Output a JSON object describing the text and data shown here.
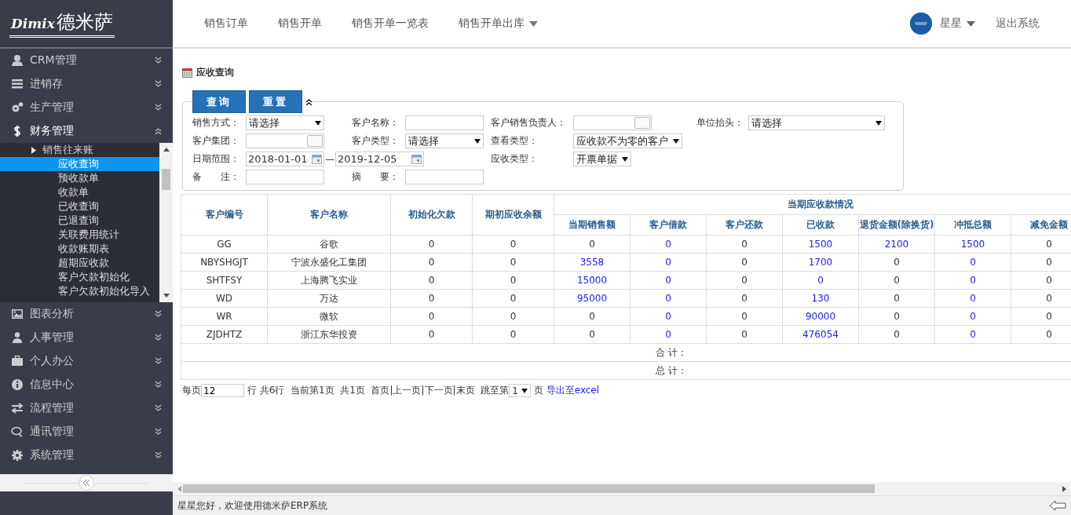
{
  "logo": {
    "script": "Dimix",
    "name": "德米萨"
  },
  "top_nav": [
    {
      "label": "销售订单",
      "dropdown": false
    },
    {
      "label": "销售开单",
      "dropdown": false
    },
    {
      "label": "销售开单一览表",
      "dropdown": false
    },
    {
      "label": "销售开单出库",
      "dropdown": true
    }
  ],
  "user": {
    "name": "星星",
    "logout": "退出系统"
  },
  "sidebar": {
    "items": [
      {
        "label": "CRM管理",
        "expanded": false
      },
      {
        "label": "进销存",
        "expanded": false
      },
      {
        "label": "生产管理",
        "expanded": false
      },
      {
        "label": "财务管理",
        "expanded": true,
        "children": [
          {
            "label": "销售往来账",
            "expanded": true,
            "children": [
              {
                "label": "应收查询",
                "selected": true
              },
              {
                "label": "预收款单",
                "selected": false
              },
              {
                "label": "收款单",
                "selected": false
              },
              {
                "label": "已收查询",
                "selected": false
              },
              {
                "label": "已退查询",
                "selected": false
              },
              {
                "label": "关联费用统计",
                "selected": false
              },
              {
                "label": "收款账期表",
                "selected": false
              },
              {
                "label": "超期应收款",
                "selected": false
              },
              {
                "label": "客户欠款初始化",
                "selected": false
              },
              {
                "label": "客户欠款初始化导入",
                "selected": false
              }
            ]
          }
        ]
      },
      {
        "label": "图表分析",
        "expanded": false
      },
      {
        "label": "人事管理",
        "expanded": false
      },
      {
        "label": "个人办公",
        "expanded": false
      },
      {
        "label": "信息中心",
        "expanded": false
      },
      {
        "label": "流程管理",
        "expanded": false
      },
      {
        "label": "通讯管理",
        "expanded": false
      },
      {
        "label": "系统管理",
        "expanded": false
      }
    ]
  },
  "page_title": "应收查询",
  "filter": {
    "buttons": [
      "查询",
      "重置"
    ],
    "expanded": true,
    "rows": [
      [
        {
          "label": "销售方式：",
          "kind": "select",
          "value": "请选择"
        },
        {
          "label": "客户名称：",
          "kind": "text"
        },
        {
          "label": "客户销售负责人：",
          "kind": "picker"
        },
        {
          "label": "单位抬头：",
          "kind": "select-wide",
          "value": "请选择"
        }
      ],
      [
        {
          "label": "客户集团：",
          "kind": "picker"
        },
        {
          "label": "客户类型：",
          "kind": "select",
          "value": "请选择"
        },
        {
          "label": "查看类型：",
          "kind": "select-auto",
          "value": "应收款不为零的客户"
        }
      ],
      [
        {
          "label": "日期范围：",
          "kind": "date-range",
          "from": "2018-01-01",
          "separator": "—",
          "to": "2019-12-05"
        },
        "",
        {
          "label": "应收类型：",
          "kind": "select-auto",
          "value": "开票单据"
        }
      ],
      [
        {
          "label": "备　　注：",
          "kind": "text"
        },
        {
          "label": "摘　　要：",
          "kind": "text"
        }
      ]
    ]
  },
  "table": {
    "columns": [
      {
        "label": "客户编号"
      },
      {
        "label": "客户名称"
      },
      {
        "label": "初始化欠款"
      },
      {
        "label": "期初应收余额"
      },
      {
        "label": "当期应收款情况",
        "colspan": 7,
        "children": [
          "当期销售额",
          "客户借款",
          "客户还款",
          "已收款",
          "退货金额(除换货)",
          "冲抵总额",
          "减免金额"
        ]
      }
    ],
    "rows": [
      [
        {
          "v": "GG",
          "link": false
        },
        {
          "v": "谷歌",
          "link": false
        },
        {
          "v": "0",
          "link": false
        },
        {
          "v": "0",
          "link": false
        },
        {
          "v": "0",
          "link": false
        },
        {
          "v": "0",
          "link": true
        },
        {
          "v": "0",
          "link": false
        },
        {
          "v": "1500",
          "link": true
        },
        {
          "v": "2100",
          "link": true
        },
        {
          "v": "1500",
          "link": true
        },
        {
          "v": "0",
          "link": false
        }
      ],
      [
        {
          "v": "NBYSHGJT",
          "link": false
        },
        {
          "v": "宁波永盛化工集团",
          "link": false
        },
        {
          "v": "0",
          "link": false
        },
        {
          "v": "0",
          "link": false
        },
        {
          "v": "3558",
          "link": true
        },
        {
          "v": "0",
          "link": true
        },
        {
          "v": "0",
          "link": false
        },
        {
          "v": "1700",
          "link": true
        },
        {
          "v": "0",
          "link": false
        },
        {
          "v": "0",
          "link": true
        },
        {
          "v": "0",
          "link": false
        }
      ],
      [
        {
          "v": "SHTFSY",
          "link": false
        },
        {
          "v": "上海腾飞实业",
          "link": false
        },
        {
          "v": "0",
          "link": false
        },
        {
          "v": "0",
          "link": false
        },
        {
          "v": "15000",
          "link": true
        },
        {
          "v": "0",
          "link": true
        },
        {
          "v": "0",
          "link": false
        },
        {
          "v": "0",
          "link": true
        },
        {
          "v": "0",
          "link": false
        },
        {
          "v": "0",
          "link": true
        },
        {
          "v": "0",
          "link": false
        }
      ],
      [
        {
          "v": "WD",
          "link": false
        },
        {
          "v": "万达",
          "link": false
        },
        {
          "v": "0",
          "link": false
        },
        {
          "v": "0",
          "link": false
        },
        {
          "v": "95000",
          "link": true
        },
        {
          "v": "0",
          "link": true
        },
        {
          "v": "0",
          "link": false
        },
        {
          "v": "130",
          "link": true
        },
        {
          "v": "0",
          "link": false
        },
        {
          "v": "0",
          "link": true
        },
        {
          "v": "0",
          "link": false
        }
      ],
      [
        {
          "v": "WR",
          "link": false
        },
        {
          "v": "微软",
          "link": false
        },
        {
          "v": "0",
          "link": false
        },
        {
          "v": "0",
          "link": false
        },
        {
          "v": "0",
          "link": false
        },
        {
          "v": "0",
          "link": true
        },
        {
          "v": "0",
          "link": false
        },
        {
          "v": "90000",
          "link": true
        },
        {
          "v": "0",
          "link": false
        },
        {
          "v": "0",
          "link": true
        },
        {
          "v": "0",
          "link": false
        }
      ],
      [
        {
          "v": "ZJDHTZ",
          "link": false
        },
        {
          "v": "浙江东华投资",
          "link": false
        },
        {
          "v": "0",
          "link": false
        },
        {
          "v": "0",
          "link": false
        },
        {
          "v": "0",
          "link": false
        },
        {
          "v": "0",
          "link": true
        },
        {
          "v": "0",
          "link": false
        },
        {
          "v": "476054",
          "link": true
        },
        {
          "v": "0",
          "link": false
        },
        {
          "v": "0",
          "link": true
        },
        {
          "v": "0",
          "link": false
        }
      ]
    ],
    "totals": [
      "合 计：",
      "总 计："
    ]
  },
  "pager": {
    "per_page_label": "每页",
    "per_page": "12",
    "info": "行 共6行  当前第1页  共1页",
    "links": "首页|上一页|下一页|末页",
    "jump_label": "跳至第",
    "page": "1",
    "page_suffix": "页",
    "export": "导出至excel"
  },
  "status_bar": "星星您好，欢迎使用德米萨ERP系统"
}
